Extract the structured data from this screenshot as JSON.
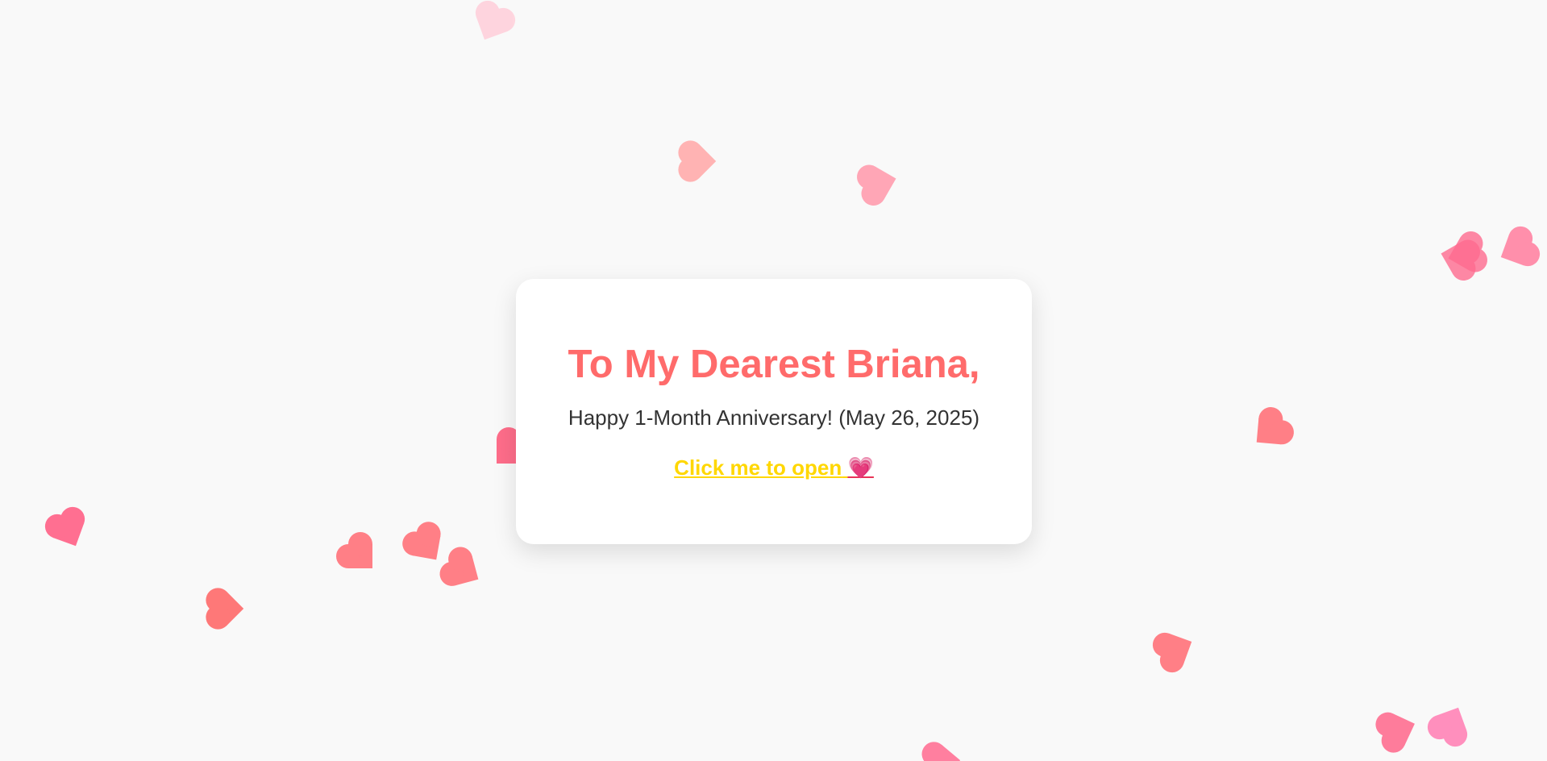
{
  "card": {
    "title": "To My Dearest Briana,",
    "subtitle": "Happy 1-Month Anniversary! (May 26, 2025)",
    "link_label": "Click me to open",
    "link_icon": "heart-emoji",
    "link_emoji": "💗"
  },
  "colors": {
    "background": "#f9f9f9",
    "card": "#ffffff",
    "title": "#ff6b6b",
    "subtitle": "#333333",
    "link": "#ffd700",
    "heart_palette": [
      "#ffd1dc",
      "#ffb3b3",
      "#ffa6b6",
      "#ff6b8f",
      "#ff7f86",
      "#ff6f91",
      "#ff8fab",
      "#ff5e7e"
    ]
  },
  "decorations": {
    "icon": "heart-icon",
    "count": 24
  }
}
